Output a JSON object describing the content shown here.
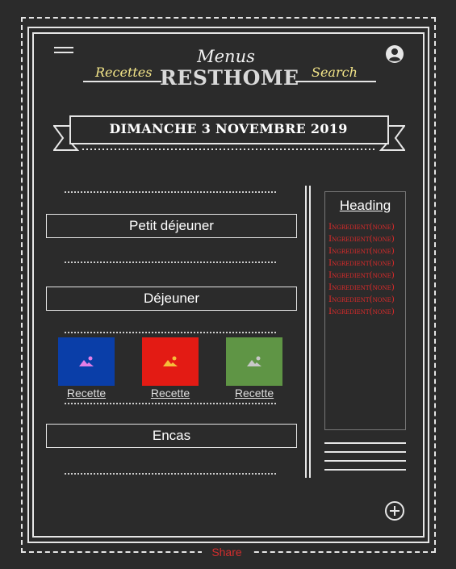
{
  "header": {
    "logo_top": "Menus",
    "logo_brand": "RESTHOME",
    "nav_left": "Recettes",
    "nav_right": "Search",
    "menu_icon": "hamburger-menu-icon",
    "account_icon": "account-circle-icon"
  },
  "date_banner": "DIMANCHE 3 NOVEMBRE 2019",
  "meals": [
    {
      "title": "Petit déjeuner"
    },
    {
      "title": "Déjeuner"
    },
    {
      "title": "Encas"
    }
  ],
  "recipes": [
    {
      "caption": "Recette",
      "color": "#0a3ea8",
      "icon": "image-placeholder-icon",
      "icon_color": "#e47ee6"
    },
    {
      "caption": "Recette",
      "color": "#e31b14",
      "icon": "image-placeholder-icon",
      "icon_color": "#f6bd3a"
    },
    {
      "caption": "Recette",
      "color": "#5f9545",
      "icon": "image-placeholder-icon",
      "icon_color": "#c8c8c8"
    }
  ],
  "sidebar": {
    "heading": "Heading",
    "ingredients": [
      "Ingredient(none)",
      "Ingredient(none)",
      "Ingredient(none)",
      "Ingredient(none)",
      "Ingredient(none)",
      "Ingredient(none)",
      "Ingredient(none)",
      "Ingredient(none)"
    ]
  },
  "add_icon": "add-circle-icon",
  "footer": {
    "share_label": "Share"
  },
  "colors": {
    "background": "#2b2b2b",
    "lines": "#e6e6e6",
    "accent_yellow": "#f2e488",
    "accent_red": "#e02b2b"
  }
}
